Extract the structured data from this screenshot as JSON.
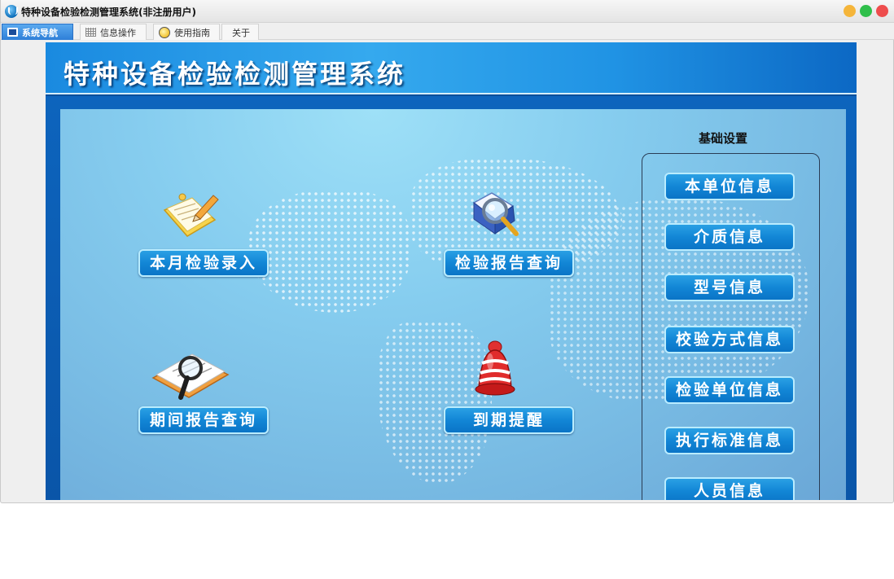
{
  "window": {
    "title": "特种设备检验检测管理系统(非注册用户)"
  },
  "tabs": [
    {
      "label": "系统导航",
      "icon": "monitor-icon",
      "active": true
    },
    {
      "label": "信息操作",
      "icon": "grid-icon",
      "active": false
    },
    {
      "label": "使用指南",
      "icon": "guide-icon",
      "active": false
    },
    {
      "label": "关于",
      "icon": null,
      "active": false
    }
  ],
  "header": {
    "title": "特种设备检验检测管理系统"
  },
  "main": {
    "monthly_entry": "本月检验录入",
    "report_query": "检验报告查询",
    "period_report_query": "期间报告查询",
    "expiry_reminder": "到期提醒"
  },
  "settings": {
    "label": "基础设置",
    "items": [
      "本单位信息",
      "介质信息",
      "型号信息",
      "校验方式信息",
      "检验单位信息",
      "执行标准信息",
      "人员信息"
    ]
  },
  "colors": {
    "accent": "#1286d6",
    "header": "#2093e4",
    "panel": "#86cdef",
    "close": "#ee4d4d",
    "minimize": "#f5b53a",
    "maximize": "#2fbf4b"
  }
}
